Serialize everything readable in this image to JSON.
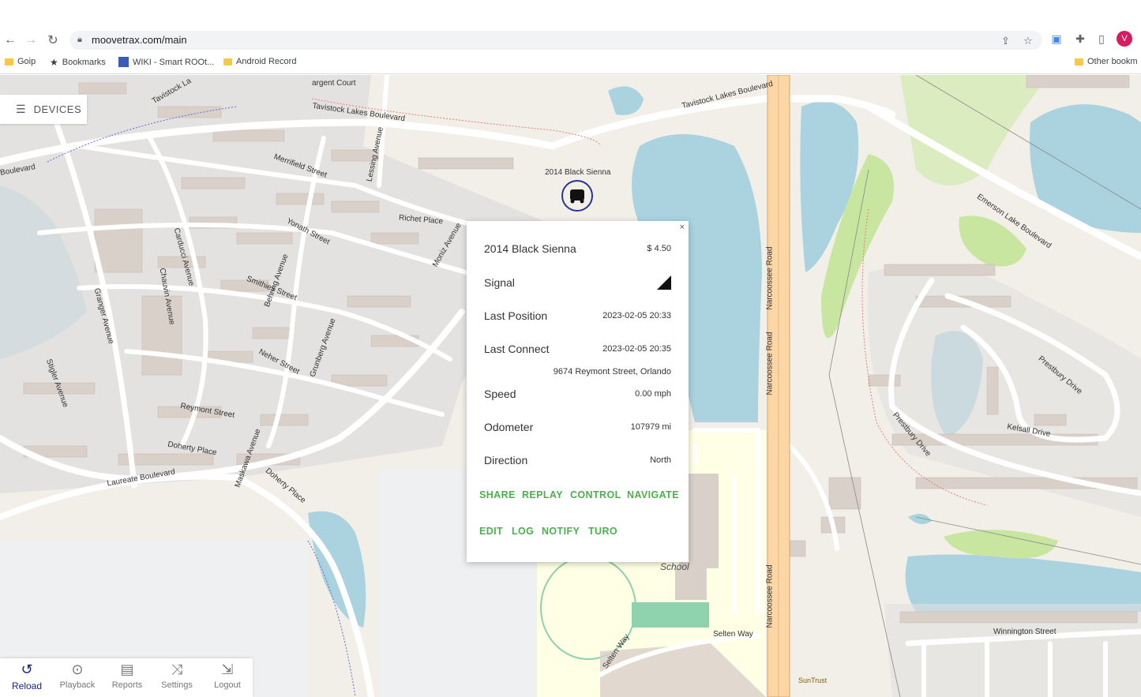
{
  "browser": {
    "url": "moovetrax.com/main",
    "avatar_letter": "V",
    "bookmarks": [
      {
        "label": "Goip",
        "icon": "folder-icon"
      },
      {
        "label": "Bookmarks",
        "icon": "star-icon"
      },
      {
        "label": "WIKI - Smart ROOt...",
        "icon": "wiki-icon"
      },
      {
        "label": "Android Record",
        "icon": "folder-icon"
      },
      {
        "label": "Other bookm",
        "icon": "folder-icon"
      }
    ]
  },
  "devices_label": "DEVICES",
  "marker_label": "2014 Black Sienna",
  "popup": {
    "close": "×",
    "title": "2014 Black Sienna",
    "price": "$ 4.50",
    "signal_label": "Signal",
    "last_position_label": "Last Position",
    "last_position_value": "2023-02-05 20:33",
    "last_connect_label": "Last Connect",
    "last_connect_value": "2023-02-05 20:35",
    "address": "9674 Reymont Street, Orlando",
    "speed_label": "Speed",
    "speed_value": "0.00 mph",
    "odometer_label": "Odometer",
    "odometer_value": "107979 mi",
    "direction_label": "Direction",
    "direction_value": "North",
    "actions_row1": [
      "SHARE",
      "REPLAY",
      "CONTROL",
      "NAVIGATE"
    ],
    "actions_row2": [
      "EDIT",
      "LOG",
      "NOTIFY",
      "TURO"
    ]
  },
  "bottom_nav": [
    {
      "label": "Reload",
      "icon": "reload-icon"
    },
    {
      "label": "Playback",
      "icon": "play-icon"
    },
    {
      "label": "Reports",
      "icon": "document-icon"
    },
    {
      "label": "Settings",
      "icon": "shuffle-icon"
    },
    {
      "label": "Logout",
      "icon": "logout-icon"
    }
  ],
  "map_labels": {
    "tavistock_blvd": "Tavistock Lakes Boulevard",
    "tavistock_la": "Tavistock La",
    "sargent": "argent Court",
    "merrifield": "Merrifield Street",
    "yonath": "Yonath Street",
    "smithies": "Smithies Street",
    "neher": "Neher Street",
    "reymont": "Reymont Street",
    "doherty": "Doherty Place",
    "laureate": "Laureate Boulevard",
    "granger": "Granger Avenue",
    "chauvin": "Chauvin Avenue",
    "carducci": "Carducci Avenue",
    "behring": "Behring Avenue",
    "grunberg": "Grunberg Avenue",
    "maskawa": "Maskawa Avenue",
    "richet": "Richet Place",
    "moniz": "Moniz Avenue",
    "lessing": "Lessing Avenue",
    "narcoossee": "Narcoossee Road",
    "selten": "Selten Way",
    "emerson": "Emerson Lake Boulevard",
    "prestbury": "Prestbury Drive",
    "kelsall": "Kelsall Drive",
    "winnington": "Winnington Street",
    "school": "School",
    "suntrust": "SunTrust",
    "boulevard": "Boulevard",
    "stigler": "Stigler Avenue"
  }
}
